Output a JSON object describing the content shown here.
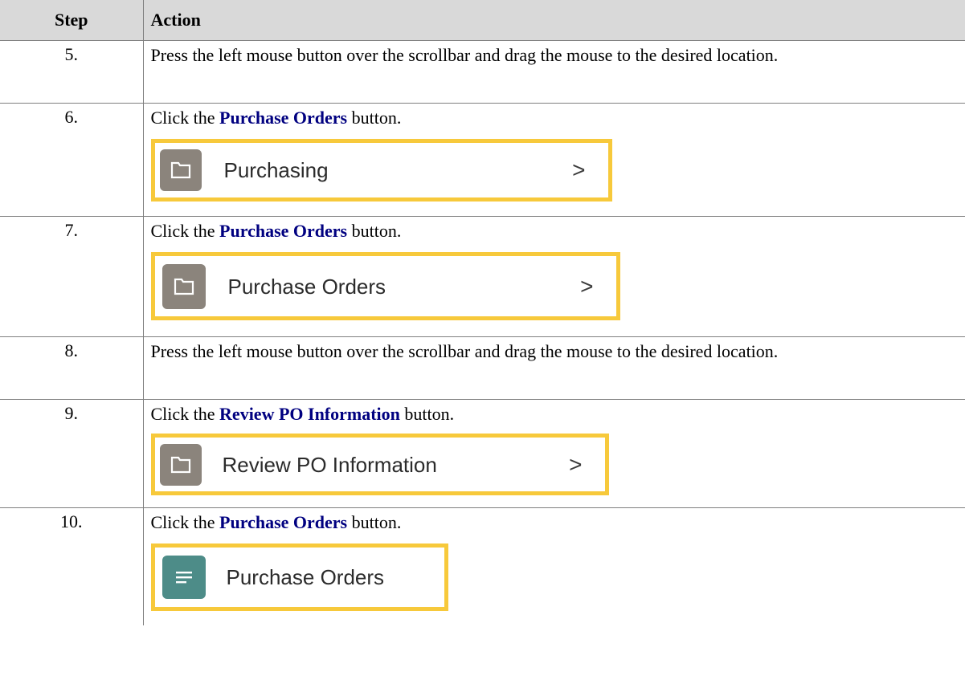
{
  "header": {
    "step": "Step",
    "action": "Action"
  },
  "rows": [
    {
      "step": "5.",
      "pre": "Press the left mouse button over the scrollbar and drag the mouse to the desired location.",
      "bold": "",
      "post": ""
    },
    {
      "step": "6.",
      "pre": "Click the ",
      "bold": "Purchase Orders",
      "post": " button.",
      "ui": {
        "icon": "folder-icon",
        "label": "Purchasing",
        "chevron": ">"
      }
    },
    {
      "step": "7.",
      "pre": "Click the ",
      "bold": "Purchase Orders",
      "post": " button.",
      "ui": {
        "icon": "folder-icon",
        "label": "Purchase Orders",
        "chevron": ">"
      }
    },
    {
      "step": "8.",
      "pre": "Press the left mouse button over the scrollbar and drag the mouse to the desired location.",
      "bold": "",
      "post": ""
    },
    {
      "step": "9.",
      "pre": "Click the ",
      "bold": "Review PO Information",
      "post": " button.",
      "ui": {
        "icon": "folder-icon",
        "label": "Review PO Information",
        "chevron": ">"
      }
    },
    {
      "step": "10.",
      "pre": "Click the ",
      "bold": "Purchase Orders",
      "post": " button.",
      "ui": {
        "icon": "list-icon",
        "label": "Purchase Orders",
        "chevron": ""
      }
    }
  ],
  "colors": {
    "header_bg": "#d9d9d9",
    "emphasis_text": "#000080",
    "highlight_border": "#f7c93b",
    "folder_icon_bg": "#8b847c",
    "list_icon_bg": "#4d8c88"
  }
}
